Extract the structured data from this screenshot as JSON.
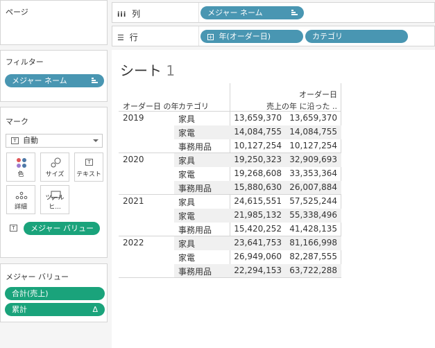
{
  "pages": {
    "title": "ページ"
  },
  "filters": {
    "title": "フィルター",
    "pill": "メジャー ネーム"
  },
  "marks": {
    "title": "マーク",
    "type_value": "自動",
    "buttons": {
      "color": "色",
      "size": "サイズ",
      "text": "テキスト",
      "detail": "詳細",
      "tooltip": "ツールヒ..."
    },
    "text_pill": "メジャー バリュー"
  },
  "measure_values": {
    "title": "メジャー バリュー",
    "items": [
      "合計(売上)",
      "累計"
    ],
    "delta": "Δ"
  },
  "columns_shelf": {
    "label": "列",
    "pill": "メジャー ネーム"
  },
  "rows_shelf": {
    "label": "行",
    "pills": [
      "年(オーダー日)",
      "カテゴリ"
    ]
  },
  "sheet": {
    "title": "シート",
    "number": "1"
  },
  "table": {
    "headers": {
      "year": "オーダー日 の年",
      "category": "カテゴリ",
      "sales": "売上",
      "cumulative_line1": "オーダー日",
      "cumulative_line2": "の年 に沿った .."
    },
    "groups": [
      {
        "year": "2019",
        "rows": [
          {
            "category": "家具",
            "sales": "13,659,370",
            "cumulative": "13,659,370"
          },
          {
            "category": "家電",
            "sales": "14,084,755",
            "cumulative": "14,084,755"
          },
          {
            "category": "事務用品",
            "sales": "10,127,254",
            "cumulative": "10,127,254"
          }
        ]
      },
      {
        "year": "2020",
        "rows": [
          {
            "category": "家具",
            "sales": "19,250,323",
            "cumulative": "32,909,693"
          },
          {
            "category": "家電",
            "sales": "19,268,608",
            "cumulative": "33,353,364"
          },
          {
            "category": "事務用品",
            "sales": "15,880,630",
            "cumulative": "26,007,884"
          }
        ]
      },
      {
        "year": "2021",
        "rows": [
          {
            "category": "家具",
            "sales": "24,615,551",
            "cumulative": "57,525,244"
          },
          {
            "category": "家電",
            "sales": "21,985,132",
            "cumulative": "55,338,496"
          },
          {
            "category": "事務用品",
            "sales": "15,420,252",
            "cumulative": "41,428,135"
          }
        ]
      },
      {
        "year": "2022",
        "rows": [
          {
            "category": "家具",
            "sales": "23,641,753",
            "cumulative": "81,166,998"
          },
          {
            "category": "家電",
            "sales": "26,949,060",
            "cumulative": "82,287,555"
          },
          {
            "category": "事務用品",
            "sales": "22,294,153",
            "cumulative": "63,722,288"
          }
        ]
      }
    ]
  }
}
